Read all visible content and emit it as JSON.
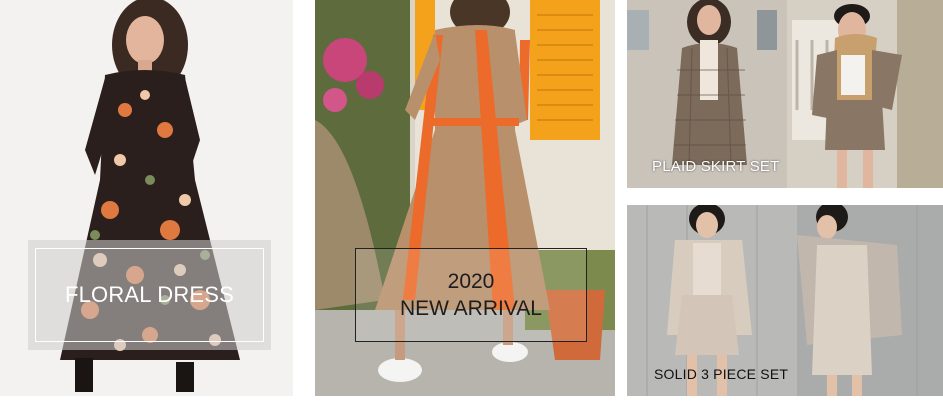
{
  "banners": {
    "floral": {
      "label": "FLORAL DRESS"
    },
    "arrival": {
      "line1": "2020",
      "line2": "NEW  ARRIVAL"
    },
    "plaid": {
      "label": "PLAID SKIRT SET"
    },
    "solid": {
      "label": "SOLID 3 PIECE SET"
    }
  },
  "colors": {
    "floral_dress": "#2a1f1c",
    "stripe_orange": "#ec6a2a",
    "shutter_yellow": "#f4a21c",
    "plaid_brown": "#7c6a5a",
    "solid_beige": "#d8ccbf"
  }
}
